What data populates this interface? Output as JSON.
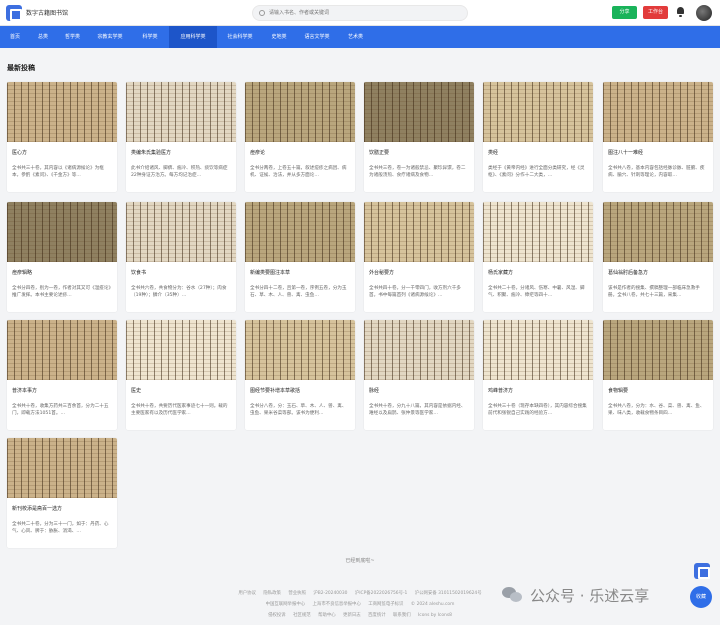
{
  "header": {
    "site_name": "数字古籍图书馆",
    "search_placeholder": "请输入书名、作者或关键词",
    "share_label": "分享",
    "workbench_label": "工作台"
  },
  "nav": {
    "items": [
      "首页",
      "总类",
      "哲学类",
      "宗教玄学类",
      "科学类",
      "应用科学类",
      "社会科学类",
      "史地类",
      "语言文学类",
      "艺术类"
    ],
    "active_index": 5
  },
  "section_title": "最新投稿",
  "cards": [
    {
      "title": "医心方",
      "desc": "全书共三十卷，其内容以《诸病源候论》为框本，参酌《素问》、《千金方》等…"
    },
    {
      "title": "类编朱氏集验医方",
      "desc": "此书介绍诸风、脚痹、痼冷、积热、痰饮等病症22种身证方治方。每方均记治症…"
    },
    {
      "title": "痘疹论",
      "desc": "全书分两卷，上卷五十篇，叙述痘疹之病因、病机、证候、治法，并从多方面论…"
    },
    {
      "title": "饮膳正要",
      "desc": "全书共三卷，卷一为诸般禁忌、聚珍异馔，卷二为诸般汤煎、食疗诸病及食物…"
    },
    {
      "title": "类经",
      "desc": "类经于《黄帝内经》进行全面分类研究，经《灵枢》、《素问》分作十二大类，…"
    },
    {
      "title": "图注八十一难经",
      "desc": "全书共八卷，基本内容包括经脉诊脉、脏腑、疾病、腧穴、针刺等理论，内容取…"
    },
    {
      "title": "痘疹辑略",
      "desc": "全书分四卷，别为一卷，作者对其又可《温疫论》推广发挥。本书主要论述痧…"
    },
    {
      "title": "饮食书",
      "desc": "全书共六卷，共食物分为：谷水（27种）；肉食（19种）；鳞介（35种）…"
    },
    {
      "title": "新编类要图注本草",
      "desc": "全书分四十二卷，且第一卷，序例五卷，分为玉石、草、木、人、兽、禽、虫鱼…"
    },
    {
      "title": "外台秘要方",
      "desc": "全书共四十卷，分一千零四门，收方剂六千多首。书中每篇首列《诸病源候论》…"
    },
    {
      "title": "杨氏家藏方",
      "desc": "全书共二十卷，分诸风、伤寒、中暑、风湿、脚气、积聚、痼冷、瘴疟等四十…"
    },
    {
      "title": "葛仙翁肘后备急方",
      "desc": "该书是作者的搜集、撰稿整理一部临床急救手册。全书八卷，共七十三篇，采集…"
    },
    {
      "title": "普济本事方",
      "desc": "全书共十卷，收集方药共三百余首，分为二十五门，即载方法1051首。…"
    },
    {
      "title": "医史",
      "desc": "全书共十卷，共要历代医家事迹七十一则。载的主要医家有以及历代医学家…"
    },
    {
      "title": "图经节要补增本草歌括",
      "desc": "全书分八卷，分：玉石、草、木、人、兽、禽、虫鱼、果米谷菜等部。该书为便利…"
    },
    {
      "title": "脉经",
      "desc": "全书共十卷，分九十八篇，其内容是依据内经、难经以及扁鹊、张仲景等医学家…"
    },
    {
      "title": "鸡峰普济方",
      "desc": "全书共三十卷（现存本缺四卷），其内容综合搜集前代和张锐自己实践的经验方…"
    },
    {
      "title": "食物辑要",
      "desc": "全书共八卷，分为：水、谷、菜、兽、禽、鱼、果、味八类，收载食物条目四…"
    },
    {
      "title": "新刊校添是斋百一选方",
      "desc": "全书共二十卷，分为三十一门，如于：丹药、心气、心风、脾于：胁胀、消渴、…"
    }
  ],
  "end_text": "已经到底啦~",
  "footer": {
    "row1": [
      "用户协议",
      "隐私政策",
      "营业执照",
      "沪B2-20240030",
      "沪ICP备2022026756号-1",
      "沪公网安备 31011502019624号"
    ],
    "row2": [
      "中国互联网举报中心",
      "上海市不良信息举报中心",
      "工商网监电子标识",
      "© 2024 aleshu.com"
    ],
    "row3": [
      "侵权投诉",
      "社区规范",
      "帮助中心",
      "更新日志",
      "百度统计",
      "联系我们",
      "Icons by Icons8"
    ]
  },
  "watermark_text": "公众号 · 乐述云享",
  "collect_label": "收藏"
}
